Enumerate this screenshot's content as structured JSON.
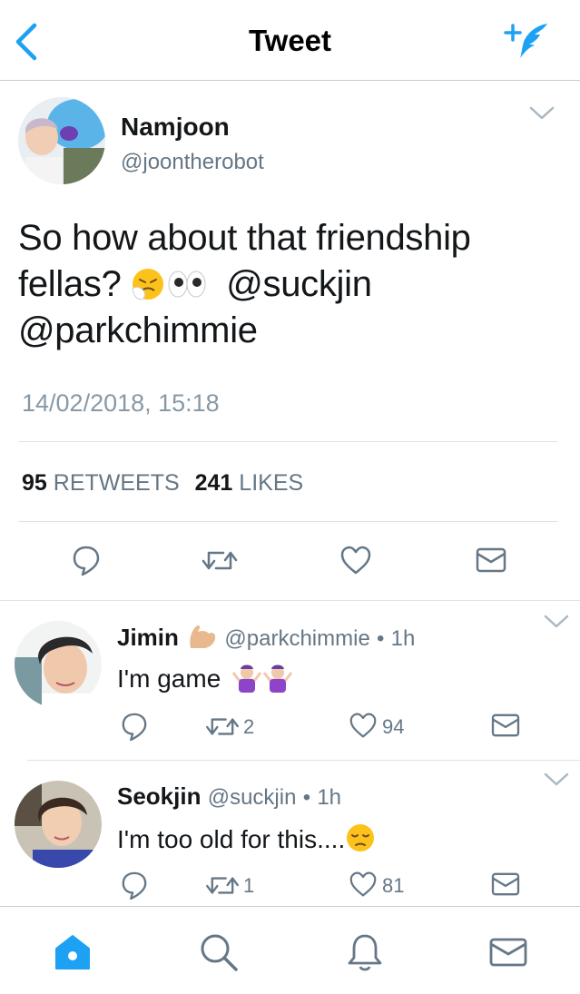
{
  "nav": {
    "title": "Tweet",
    "back_icon": "chevron-left-icon",
    "compose_icon": "compose-tweet-icon",
    "accent": "#1da1f2"
  },
  "main_tweet": {
    "name": "Namjoon",
    "handle": "@joontherobot",
    "text_line1": "So how about that friendship",
    "text_line2_prefix": "fellas?",
    "emojis": [
      "sneezing-face",
      "eyes"
    ],
    "mention1": "@suckjin",
    "mention2": "@parkchimmie",
    "timestamp": "14/02/2018, 15:18",
    "retweet_count": "95",
    "retweets_label": "RETWEETS",
    "like_count": "241",
    "likes_label": "LIKES"
  },
  "replies": [
    {
      "name": "Jimin",
      "name_emoji": "flexed-biceps",
      "handle": "@parkchimmie",
      "separator": "•",
      "age": "1h",
      "text": "I'm game",
      "text_emojis": [
        "person-shrugging",
        "person-shrugging"
      ],
      "retweets": "2",
      "likes": "94"
    },
    {
      "name": "Seokjin",
      "handle": "@suckjin",
      "separator": "•",
      "age": "1h",
      "text": "I'm too old for this....",
      "text_emojis": [
        "pensive-face"
      ],
      "retweets": "1",
      "likes": "81"
    }
  ],
  "tabs": [
    "home-icon",
    "search-icon",
    "notifications-icon",
    "messages-icon"
  ],
  "colors": {
    "text": "#14171a",
    "secondary": "#657786",
    "accent": "#1da1f2",
    "divider": "#dfe3e7",
    "icon_gray": "#657786"
  }
}
